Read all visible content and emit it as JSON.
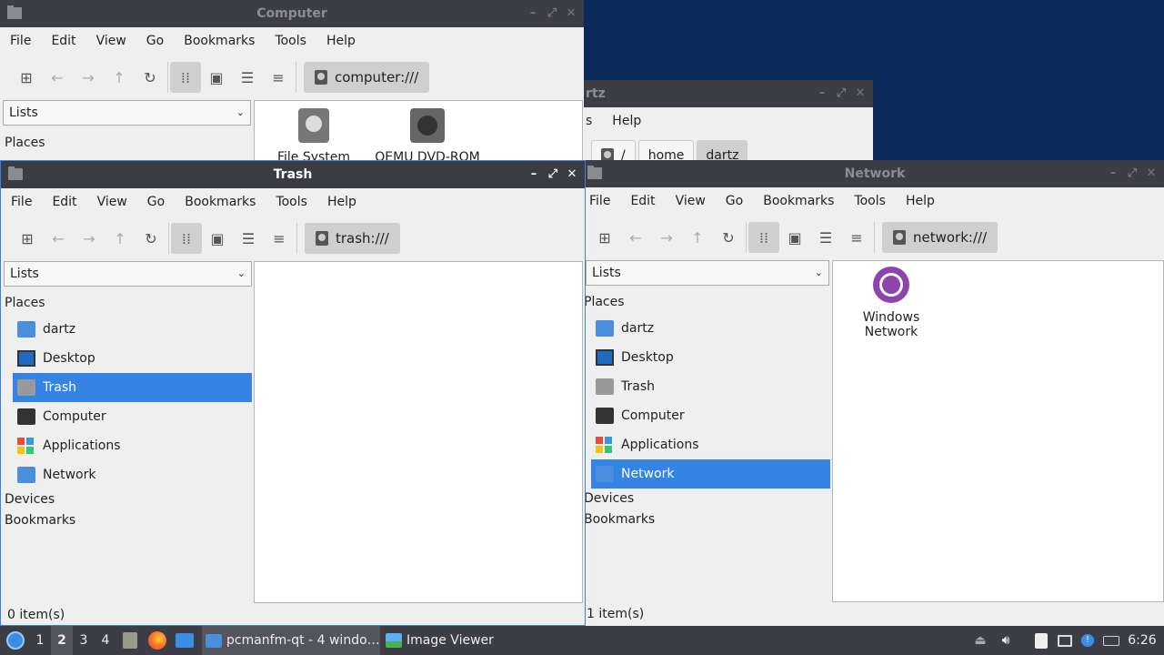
{
  "menu": [
    "File",
    "Edit",
    "View",
    "Go",
    "Bookmarks",
    "Tools",
    "Help"
  ],
  "computer": {
    "title": "Computer",
    "path": "computer:///",
    "lists": "Lists",
    "places": "Places",
    "items": [
      "File System",
      "QEMU DVD-ROM"
    ]
  },
  "home_window": {
    "title_fragment": "rtz",
    "menu_fragment": [
      "s",
      "Help"
    ],
    "crumbs": [
      "/",
      "home",
      "dartz"
    ]
  },
  "trash": {
    "title": "Trash",
    "path": "trash:///",
    "lists": "Lists",
    "places": "Places",
    "sidebar": [
      "dartz",
      "Desktop",
      "Trash",
      "Computer",
      "Applications",
      "Network"
    ],
    "devices": "Devices",
    "bookmarks": "Bookmarks",
    "status": "0 item(s)"
  },
  "network": {
    "title": "Network",
    "path": "network:///",
    "lists": "Lists",
    "places": "Places",
    "sidebar": [
      "dartz",
      "Desktop",
      "Trash",
      "Computer",
      "Applications",
      "Network"
    ],
    "devices": "Devices",
    "bookmarks": "Bookmarks",
    "item_line1": "Windows",
    "item_line2": "Network",
    "status": "1 item(s)"
  },
  "taskbar": {
    "workspaces": [
      "1",
      "2",
      "3",
      "4"
    ],
    "task1": "pcmanfm-qt - 4 windo…",
    "task2": "Image Viewer",
    "clock": "6:26"
  },
  "colors": {
    "selection": "#3584e4",
    "titlebar": "#3c3d45",
    "desktop": "#0a2a5a"
  }
}
